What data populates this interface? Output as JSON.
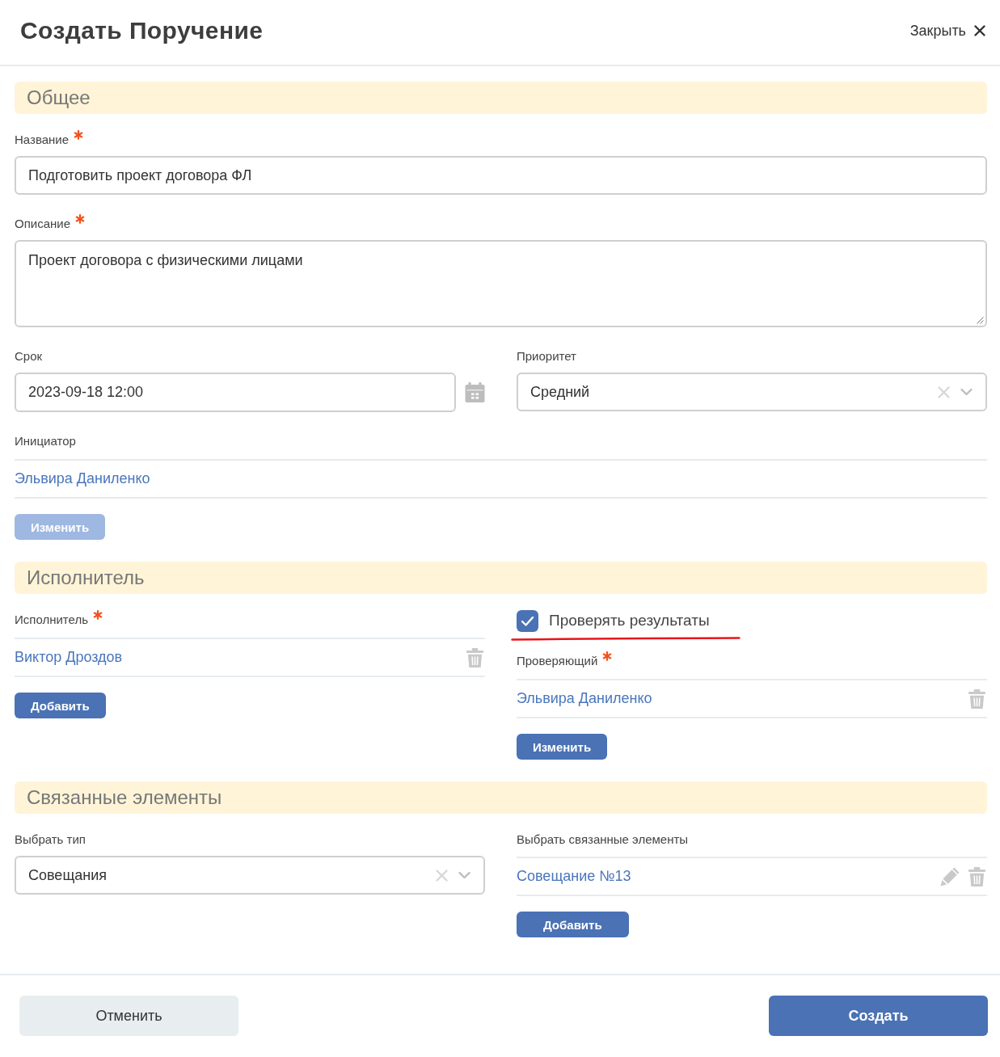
{
  "header": {
    "title": "Создать Поручение",
    "close_label": "Закрыть"
  },
  "general": {
    "title": "Общее",
    "name": {
      "label": "Название",
      "required": true,
      "value": "Подготовить проект договора ФЛ"
    },
    "description": {
      "label": "Описание",
      "required": true,
      "value": "Проект договора с физическими лицами"
    },
    "deadline": {
      "label": "Срок",
      "required": false,
      "value": "2023-09-18 12:00"
    },
    "priority": {
      "label": "Приоритет",
      "required": false,
      "value": "Средний"
    },
    "initiator": {
      "label": "Инициатор",
      "required": false,
      "removable": false,
      "editable": false,
      "people": [
        "Эльвира Даниленко"
      ],
      "button": {
        "label": "Изменить",
        "disabled": true
      }
    }
  },
  "executor": {
    "title": "Исполнитель",
    "executors": {
      "label": "Исполнитель",
      "required": true,
      "removable": true,
      "editable": false,
      "people": [
        "Виктор Дроздов"
      ],
      "button": {
        "label": "Добавить",
        "disabled": false
      }
    },
    "check_results": {
      "label": "Проверять результаты",
      "checked": true,
      "highlighted": true
    },
    "reviewer": {
      "label": "Проверяющий",
      "required": true,
      "removable": true,
      "editable": false,
      "people": [
        "Эльвира Даниленко"
      ],
      "button": {
        "label": "Изменить",
        "disabled": false
      }
    }
  },
  "related": {
    "title": "Связанные элементы",
    "type": {
      "label": "Выбрать тип",
      "required": false,
      "value": "Совещания"
    },
    "items": {
      "label": "Выбрать связанные элементы",
      "required": false,
      "removable": true,
      "editable": true,
      "entries": [
        "Совещание №13"
      ],
      "button": {
        "label": "Добавить",
        "disabled": false
      }
    }
  },
  "footer": {
    "cancel": "Отменить",
    "submit": "Создать"
  }
}
